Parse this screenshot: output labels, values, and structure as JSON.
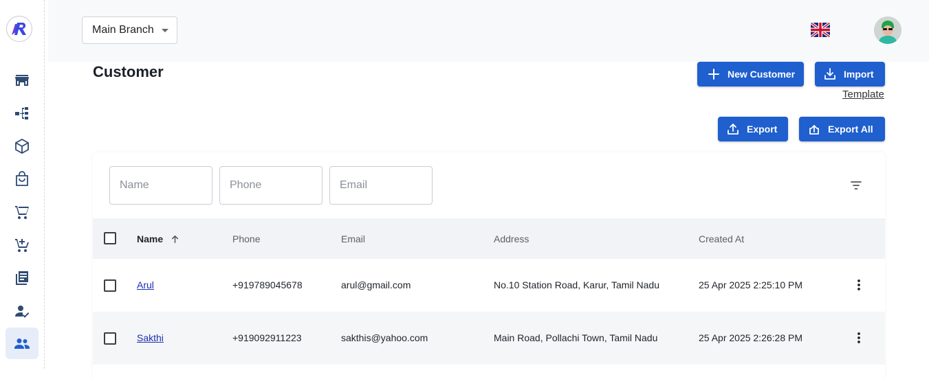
{
  "sidebar": {
    "items": [
      {
        "icon": "store-icon"
      },
      {
        "icon": "hierarchy-icon"
      },
      {
        "icon": "package-icon"
      },
      {
        "icon": "shopping-bag-icon"
      },
      {
        "icon": "cart-icon"
      },
      {
        "icon": "cart-add-icon"
      },
      {
        "icon": "receipt-icon"
      },
      {
        "icon": "person-check-icon"
      },
      {
        "icon": "people-icon",
        "active": true
      }
    ]
  },
  "header": {
    "branch": "Main Branch"
  },
  "main": {
    "title": "Customer",
    "new_customer_label": "New Customer",
    "import_label": "Import",
    "template_label": "Template",
    "export_label": "Export",
    "export_all_label": "Export All"
  },
  "filters": {
    "name_placeholder": "Name",
    "phone_placeholder": "Phone",
    "email_placeholder": "Email"
  },
  "table": {
    "columns": {
      "name": "Name",
      "phone": "Phone",
      "email": "Email",
      "address": "Address",
      "created_at": "Created At"
    },
    "rows": [
      {
        "name": "Arul",
        "phone": "+919789045678",
        "email": "arul@gmail.com",
        "address": "No.10 Station Road, Karur, Tamil Nadu",
        "created_at": "25 Apr 2025 2:25:10 PM"
      },
      {
        "name": "Sakthi",
        "phone": "+919092911223",
        "email": "sakthis@yahoo.com",
        "address": "Main Road, Pollachi Town, Tamil Nadu",
        "created_at": "25 Apr 2025 2:26:28 PM"
      }
    ]
  },
  "colors": {
    "primary": "#1f5fce",
    "sidebar_icon": "#2f4a73",
    "active_bg": "#e6edf8"
  }
}
